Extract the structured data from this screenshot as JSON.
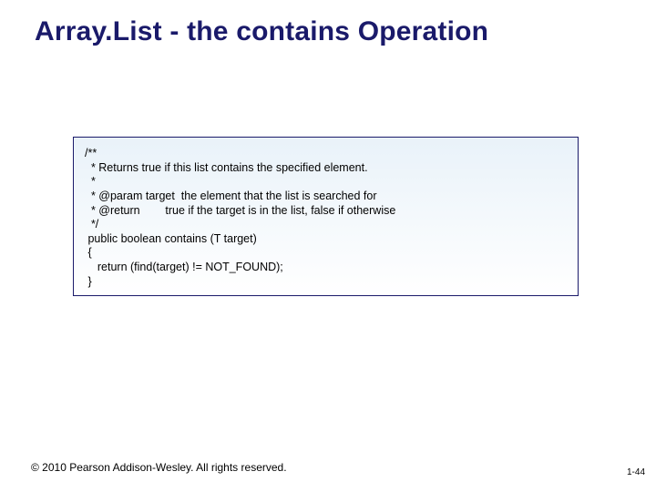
{
  "title": "Array.List - the contains Operation",
  "code": {
    "l1": "/**",
    "l2": "  * Returns true if this list contains the specified element.",
    "l3": "  *",
    "l4": "  * @param target  the element that the list is searched for",
    "l5": "  * @return        true if the target is in the list, false if otherwise",
    "l6": "  */",
    "l7": " public boolean contains (T target)",
    "l8": " {",
    "l9": "    return (find(target) != NOT_FOUND);",
    "l10": " }"
  },
  "footer": {
    "copyright": "© 2010 Pearson Addison-Wesley. All rights reserved.",
    "page": "1-44"
  }
}
